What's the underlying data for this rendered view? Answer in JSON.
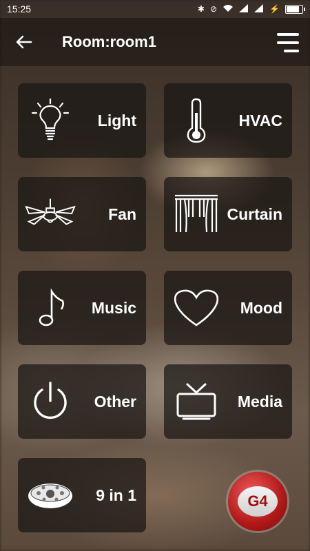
{
  "status": {
    "time": "15:25",
    "icons": [
      "bluetooth-icon",
      "alarm-off-icon",
      "wifi-icon",
      "signal-icon",
      "signal-icon",
      "charging-icon",
      "battery-icon"
    ]
  },
  "header": {
    "title": "Room:room1",
    "back_icon": "arrow-left-icon",
    "menu_icon": "menu-icon"
  },
  "tiles": [
    {
      "label": "Light",
      "icon": "lightbulb-icon"
    },
    {
      "label": "HVAC",
      "icon": "thermometer-icon"
    },
    {
      "label": "Fan",
      "icon": "ceiling-fan-icon"
    },
    {
      "label": "Curtain",
      "icon": "curtain-icon"
    },
    {
      "label": "Music",
      "icon": "music-note-icon"
    },
    {
      "label": "Mood",
      "icon": "heart-icon"
    },
    {
      "label": "Other",
      "icon": "power-icon"
    },
    {
      "label": "Media",
      "icon": "tv-icon"
    },
    {
      "label": "9 in 1",
      "icon": "sensor-9in1-icon"
    }
  ],
  "brand": {
    "badge": "G4",
    "color": "#c01c1c"
  }
}
